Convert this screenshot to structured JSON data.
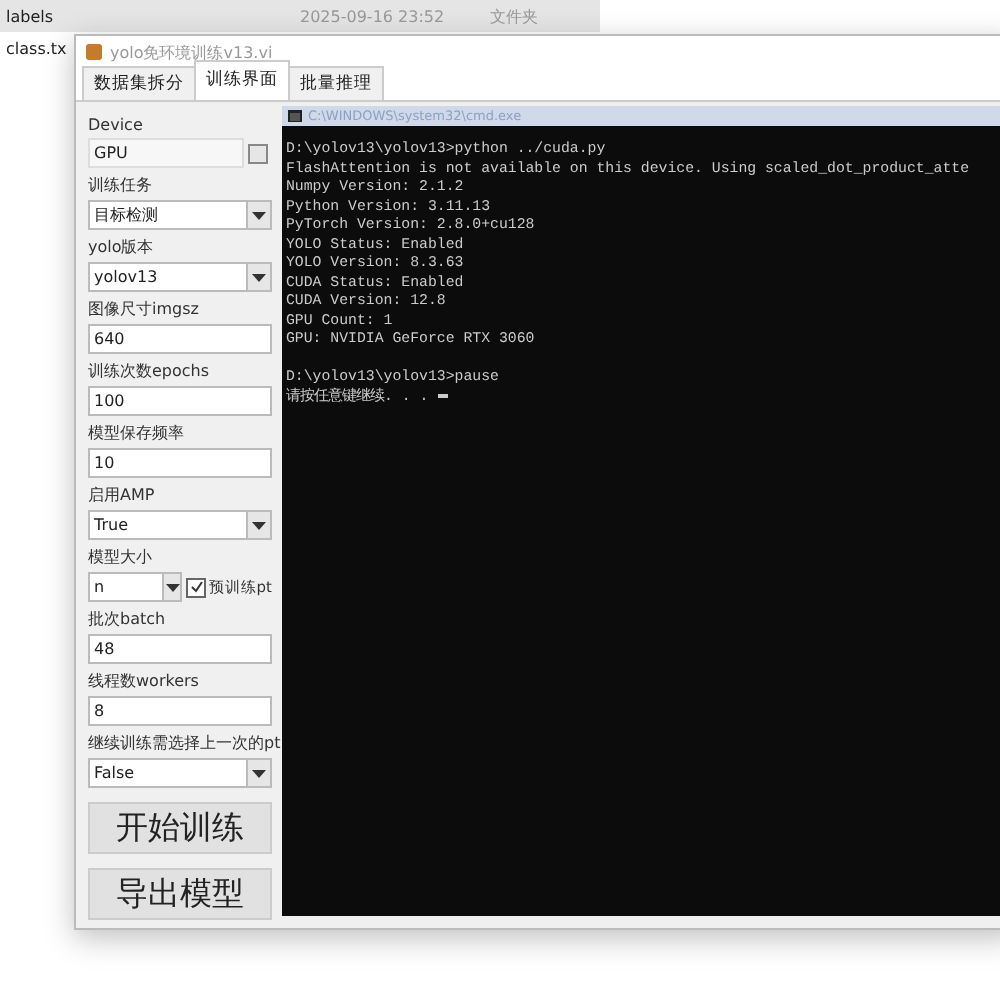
{
  "explorer": {
    "rows": [
      {
        "name": "labels",
        "date": "2025-09-16 23:52",
        "type": "文件夹",
        "selected": true
      },
      {
        "name": "class.tx",
        "selected": false
      }
    ]
  },
  "window": {
    "title": "yolo免环境训练v13.vi",
    "tabs": [
      {
        "label": "数据集拆分",
        "selected": false
      },
      {
        "label": "训练界面",
        "selected": true
      },
      {
        "label": "批量推理",
        "selected": false
      }
    ],
    "settings": [
      {
        "kind": "readonly",
        "label": "Device",
        "value": "GPU"
      },
      {
        "kind": "select",
        "label": "训练任务",
        "value": "目标检测"
      },
      {
        "kind": "select",
        "label": "yolo版本",
        "value": "yolov13"
      },
      {
        "kind": "input",
        "label": "图像尺寸imgsz",
        "value": "640"
      },
      {
        "kind": "input",
        "label": "训练次数epochs",
        "value": "100"
      },
      {
        "kind": "input",
        "label": "模型保存频率",
        "value": "10"
      },
      {
        "kind": "select",
        "label": "启用AMP",
        "value": "True"
      },
      {
        "kind": "select_check",
        "label": "模型大小",
        "value": "n",
        "check_label": "预训练pt",
        "checked": true
      },
      {
        "kind": "input",
        "label": "批次batch",
        "value": "48"
      },
      {
        "kind": "input",
        "label": "线程数workers",
        "value": "8"
      },
      {
        "kind": "select",
        "label": "继续训练需选择上一次的pt",
        "value": "False"
      }
    ],
    "buttons": [
      "开始训练",
      "导出模型"
    ],
    "console": {
      "title": "C:\\WINDOWS\\system32\\cmd.exe",
      "blocks": [
        [
          "D:\\yolov13\\yolov13>python ../cuda.py",
          "FlashAttention is not available on this device. Using scaled_dot_product_atte",
          "Numpy Version: 2.1.2",
          "Python Version: 3.11.13",
          "PyTorch Version: 2.8.0+cu128",
          "YOLO Status: Enabled",
          "YOLO Version: 8.3.63",
          "CUDA Status: Enabled",
          "CUDA Version: 12.8",
          "GPU Count: 1",
          "GPU: NVIDIA GeForce RTX 3060"
        ],
        [
          "D:\\yolov13\\yolov13>pause",
          "请按任意键继续. . . "
        ]
      ]
    }
  }
}
